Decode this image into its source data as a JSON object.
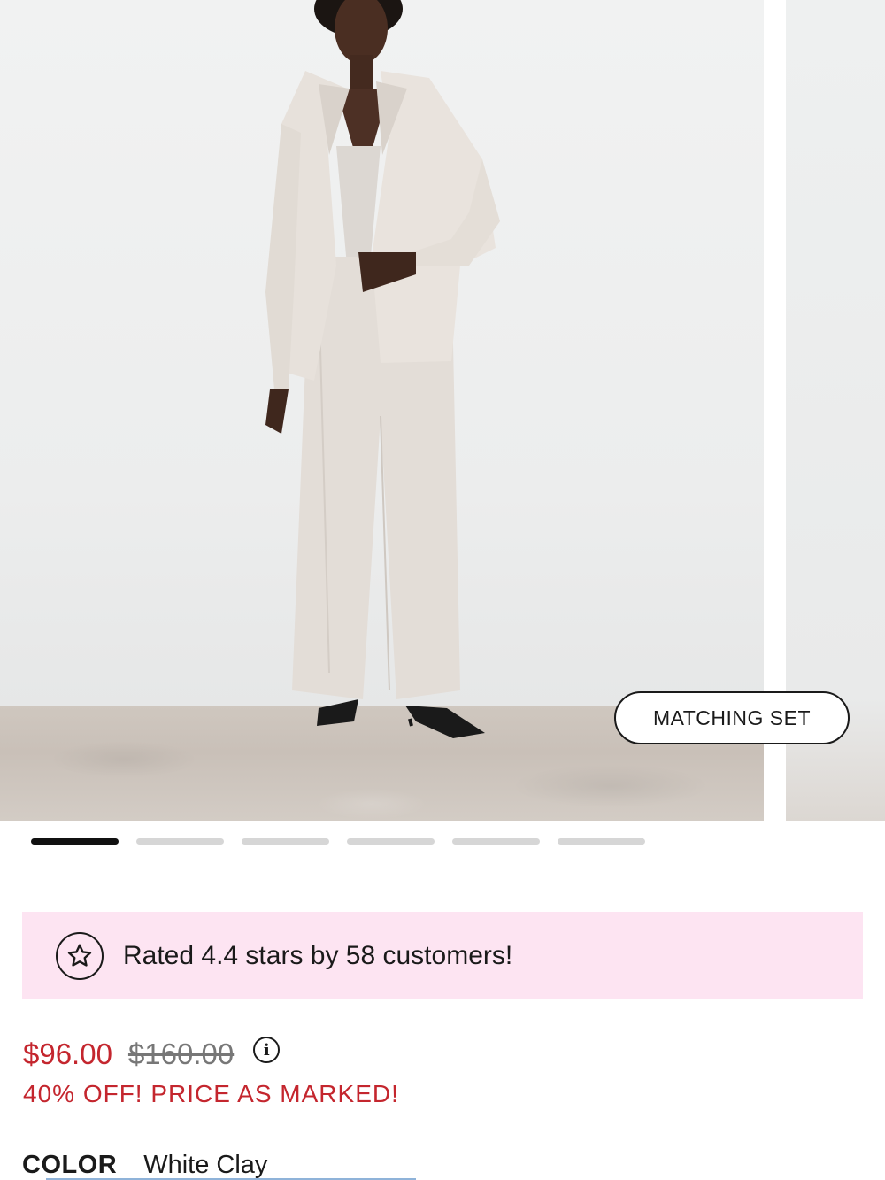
{
  "product": {
    "badge_label": "MATCHING SET",
    "carousel_total": 6,
    "carousel_active": 1
  },
  "rating": {
    "text": "Rated 4.4 stars by 58 customers!",
    "icon": "star-icon"
  },
  "price": {
    "sale": "$96.00",
    "original": "$160.00",
    "promo": "40% OFF! PRICE AS MARKED!",
    "info_icon": "info-icon"
  },
  "color": {
    "label": "COLOR",
    "value": "White Clay"
  },
  "colors": {
    "sale_red": "#c4262e",
    "banner_pink": "#fde4f2",
    "active_dot": "#111111",
    "inactive_dot": "#d6d6d6"
  }
}
